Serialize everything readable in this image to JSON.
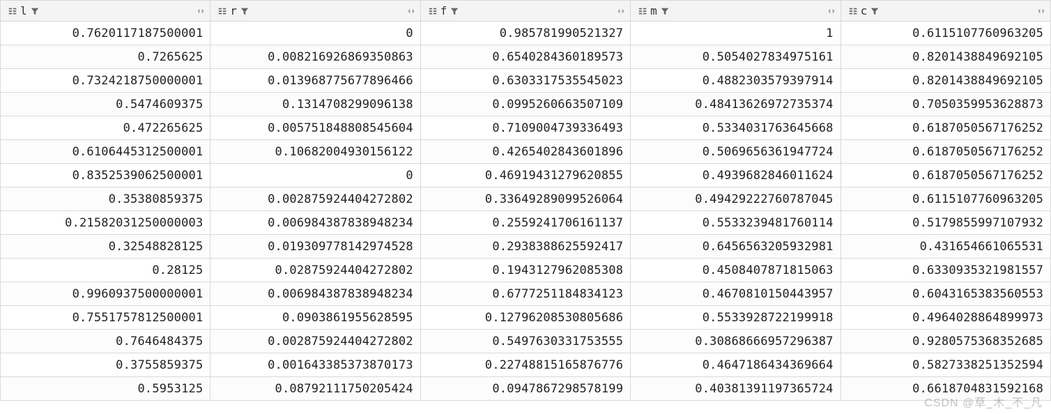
{
  "columns": [
    {
      "name": "l"
    },
    {
      "name": "r"
    },
    {
      "name": "f"
    },
    {
      "name": "m"
    },
    {
      "name": "c"
    }
  ],
  "rows": [
    [
      "0.7620117187500001",
      "0",
      "0.985781990521327",
      "1",
      "0.6115107760963205"
    ],
    [
      "0.7265625",
      "0.008216926869350863",
      "0.6540284360189573",
      "0.5054027834975161",
      "0.8201438849692105"
    ],
    [
      "0.7324218750000001",
      "0.013968775677896466",
      "0.6303317535545023",
      "0.4882303579397914",
      "0.8201438849692105"
    ],
    [
      "0.5474609375",
      "0.1314708299096138",
      "0.0995260663507109",
      "0.48413626972735374",
      "0.7050359953628873"
    ],
    [
      "0.472265625",
      "0.005751848808545604",
      "0.7109004739336493",
      "0.5334031763645668",
      "0.6187050567176252"
    ],
    [
      "0.6106445312500001",
      "0.10682004930156122",
      "0.4265402843601896",
      "0.5069656361947724",
      "0.6187050567176252"
    ],
    [
      "0.8352539062500001",
      "0",
      "0.46919431279620855",
      "0.4939682846011624",
      "0.6187050567176252"
    ],
    [
      "0.35380859375",
      "0.002875924404272802",
      "0.33649289099526064",
      "0.49429222760787045",
      "0.6115107760963205"
    ],
    [
      "0.21582031250000003",
      "0.006984387838948234",
      "0.2559241706161137",
      "0.5533239481760114",
      "0.5179855997107932"
    ],
    [
      "0.32548828125",
      "0.019309778142974528",
      "0.2938388625592417",
      "0.6456563205932981",
      "0.431654661065531"
    ],
    [
      "0.28125",
      "0.02875924404272802",
      "0.1943127962085308",
      "0.4508407871815063",
      "0.6330935321981557"
    ],
    [
      "0.9960937500000001",
      "0.006984387838948234",
      "0.6777251184834123",
      "0.4670810150443957",
      "0.6043165383560553"
    ],
    [
      "0.7551757812500001",
      "0.0903861955628595",
      "0.12796208530805686",
      "0.5533928722199918",
      "0.4964028864899973"
    ],
    [
      "0.7646484375",
      "0.002875924404272802",
      "0.5497630331753555",
      "0.30868666957296387",
      "0.9280575368352685"
    ],
    [
      "0.3755859375",
      "0.001643385373870173",
      "0.22748815165876776",
      "0.4647186434369664",
      "0.5827338251352594"
    ],
    [
      "0.5953125",
      "0.08792111750205424",
      "0.0947867298578199",
      "0.40381391197365724",
      "0.6618704831592168"
    ]
  ],
  "watermark": "CSDN @草_木_不_凡"
}
